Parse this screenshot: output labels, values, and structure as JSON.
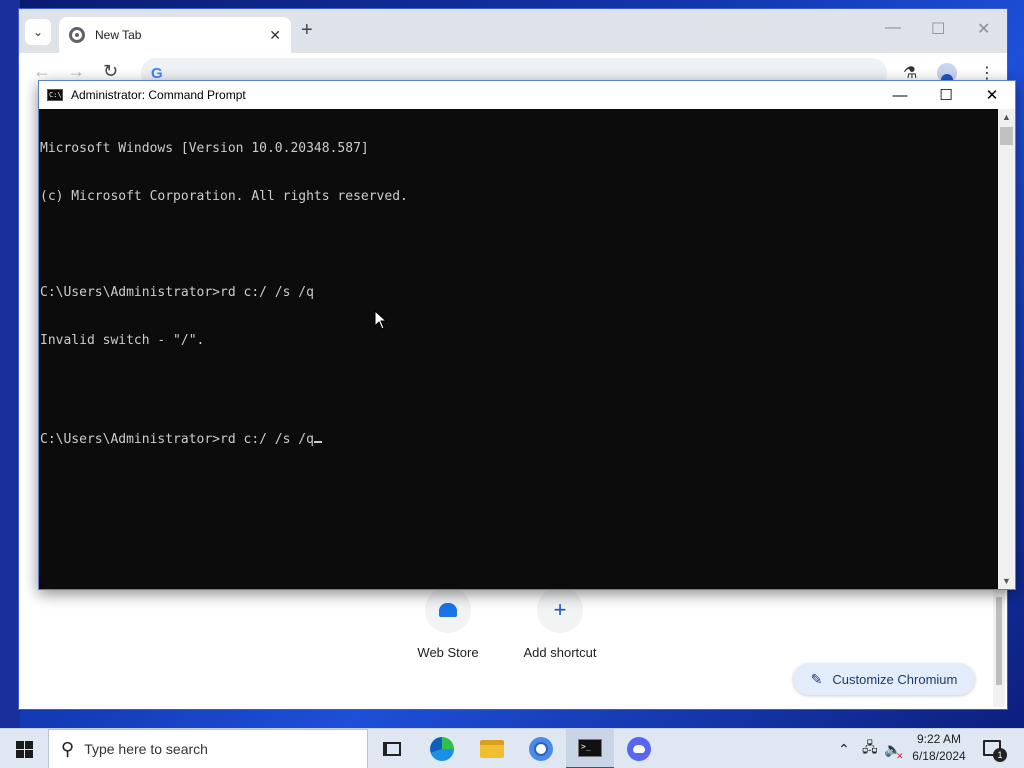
{
  "browser": {
    "tab": {
      "title": "New Tab"
    },
    "controls": {
      "search_tabs": "⌄",
      "new_tab": "+",
      "close_tab": "✕",
      "minimize": "—",
      "maximize": "☐",
      "close": "✕"
    },
    "toolbar": {
      "back": "←",
      "forward": "→",
      "reload": "↻",
      "omnibox_logo": "G",
      "labs": "⚗",
      "menu": "⋮"
    },
    "shortcuts": [
      {
        "label": "Web Store",
        "icon": "webstore-icon"
      },
      {
        "label": "Add shortcut",
        "icon": "plus-icon",
        "glyph": "+"
      }
    ],
    "customize_label": "Customize Chromium"
  },
  "cmd": {
    "title": "Administrator: Command Prompt",
    "lines": [
      "Microsoft Windows [Version 10.0.20348.587]",
      "(c) Microsoft Corporation. All rights reserved.",
      "",
      "C:\\Users\\Administrator>rd c:/ /s /q",
      "Invalid switch - \"/\".",
      "",
      "C:\\Users\\Administrator>rd c:/ /s /q"
    ],
    "controls": {
      "minimize": "—",
      "maximize": "☐",
      "close": "✕"
    },
    "icon_text": "C:\\"
  },
  "taskbar": {
    "search_placeholder": "Type here to search",
    "apps": [
      "task-view",
      "edge",
      "file-explorer",
      "chromium",
      "command-prompt",
      "discord"
    ],
    "terminal_icon_text": ">_",
    "tray": {
      "chevron": "⌃",
      "network": "🖧",
      "volume": "🔈",
      "mute": "✕"
    },
    "time": "9:22 AM",
    "date": "6/18/2024",
    "notification_count": "1"
  }
}
